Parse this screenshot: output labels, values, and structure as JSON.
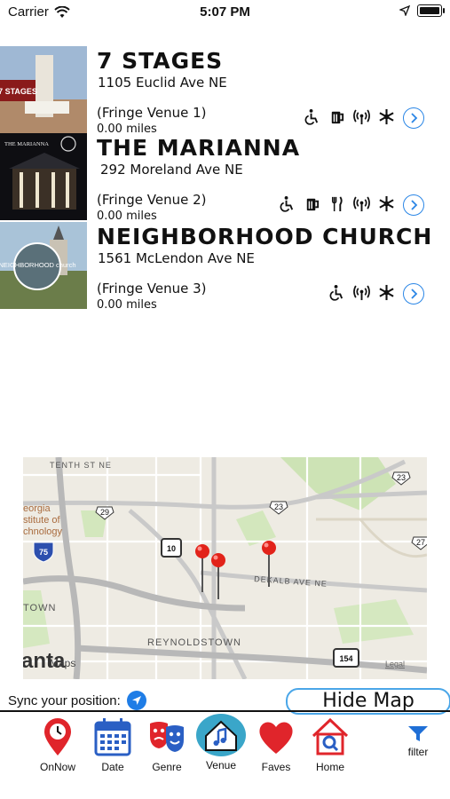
{
  "status": {
    "carrier": "Carrier",
    "time": "5:07 PM"
  },
  "venues": [
    {
      "name": "7 STAGES",
      "address": "1105 Euclid Ave NE",
      "fringe": "(Fringe Venue 1)",
      "distance": "0.00 miles",
      "thumb_text": "7 STAGES",
      "amenities": [
        "wheelchair-icon",
        "beer-icon",
        "wifi-icon",
        "snowflake-icon"
      ]
    },
    {
      "name": "THE MARIANNA",
      "address": "292 Moreland Ave NE",
      "fringe": "(Fringe Venue 2)",
      "distance": "0.00 miles",
      "thumb_text": "THE MARIANNA",
      "amenities": [
        "wheelchair-icon",
        "beer-icon",
        "fork-knife-icon",
        "wifi-icon",
        "snowflake-icon"
      ]
    },
    {
      "name": "NEIGHBORHOOD CHURCH",
      "address": "1561 McLendon Ave NE",
      "fringe": "(Fringe Venue 3)",
      "distance": "0.00 miles",
      "thumb_text": "NEIGHBORHOOD church",
      "amenities": [
        "wheelchair-icon",
        "wifi-icon",
        "snowflake-icon"
      ]
    }
  ],
  "map": {
    "labels": {
      "tenth": "TENTH ST NE",
      "georgia1": "eorgia",
      "georgia2": "stitute of",
      "georgia3": "chnology",
      "dekalb": "DEKALB AVE NE",
      "town": "TOWN",
      "reynolds": "REYNOLDSTOWN",
      "anta": "anta",
      "maps": "Maps",
      "legal": "Legal"
    },
    "shields": {
      "s29": "29",
      "s23a": "23",
      "s23b": "23",
      "s10": "10",
      "s75": "75",
      "s154": "154",
      "s27": "27"
    }
  },
  "sync_label": "Sync your position:",
  "hide_map_label": "Hide Map",
  "tabs": [
    {
      "label": "OnNow",
      "icon": "map-pin-clock-icon"
    },
    {
      "label": "Date",
      "icon": "calendar-icon"
    },
    {
      "label": "Genre",
      "icon": "theater-masks-icon"
    },
    {
      "label": "Venue",
      "icon": "venue-music-icon"
    },
    {
      "label": "Faves",
      "icon": "heart-icon"
    },
    {
      "label": "Home",
      "icon": "home-icon"
    }
  ],
  "filter_label": "filter",
  "colors": {
    "accent_blue": "#2a86e6",
    "tab_red": "#e0252b",
    "tab_blue": "#2a5fc4",
    "venue_active": "#3aa6c9"
  }
}
